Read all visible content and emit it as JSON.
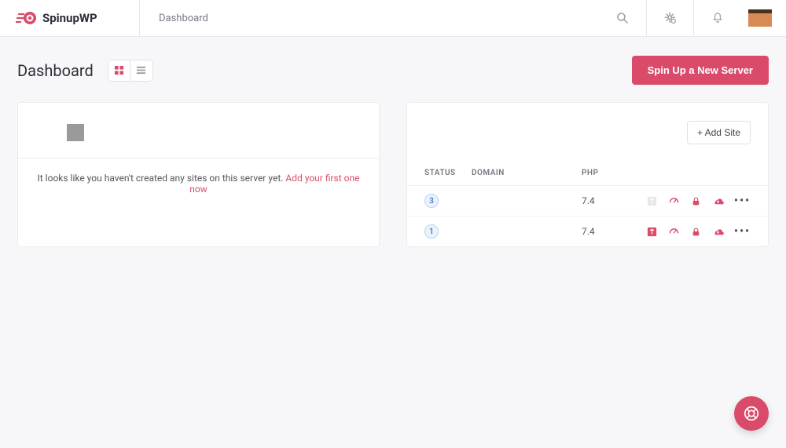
{
  "brand": {
    "name": "SpinupWP"
  },
  "breadcrumb": "Dashboard",
  "page_title": "Dashboard",
  "primary_action": "Spin Up a New Server",
  "colors": {
    "accent": "#da4b6a"
  },
  "servers": [
    {
      "emptyState": {
        "message": "It looks like you haven't created any sites on this server yet.",
        "linkText": "Add your first one now"
      }
    },
    {
      "addSiteLabel": "+ Add Site",
      "columns": {
        "status": "STATUS",
        "domain": "DOMAIN",
        "php": "PHP"
      },
      "sites": [
        {
          "status": "3",
          "domain": "",
          "php": "7.4",
          "gitActive": false
        },
        {
          "status": "1",
          "domain": "",
          "php": "7.4",
          "gitActive": true
        }
      ]
    }
  ]
}
